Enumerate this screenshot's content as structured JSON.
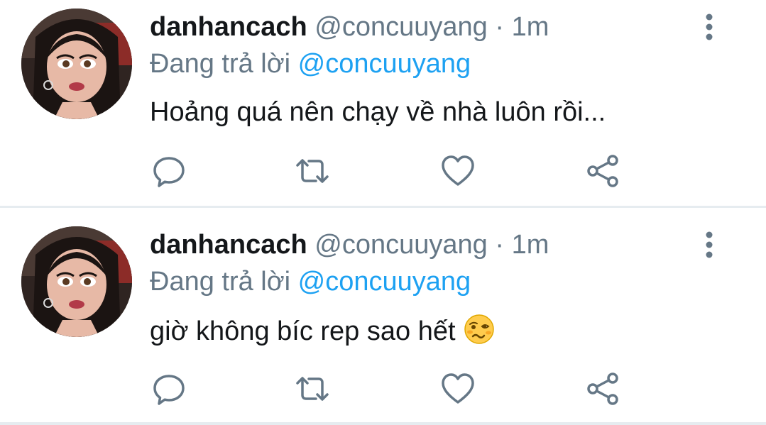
{
  "tweets": [
    {
      "name": "danhancach",
      "handle": "@concuuyang",
      "separator": "·",
      "time": "1m",
      "reply_prefix": "Đang trả lời",
      "reply_to": "@concuuyang",
      "text": "Hoảng quá nên chạy về nhà luôn rồi...",
      "emoji": ""
    },
    {
      "name": "danhancach",
      "handle": "@concuuyang",
      "separator": "·",
      "time": "1m",
      "reply_prefix": "Đang trả lời",
      "reply_to": "@concuuyang",
      "text": "giờ không bíc rep sao hết",
      "emoji": "woozy-face"
    }
  ],
  "icons": {
    "reply": "comment-icon",
    "retweet": "retweet-icon",
    "like": "heart-icon",
    "share": "share-icon",
    "more": "more-vertical-icon"
  },
  "colors": {
    "name": "#14171a",
    "secondary": "#657786",
    "mention": "#1da1f2",
    "divider": "#e6ecf0",
    "icon": "#657786"
  }
}
